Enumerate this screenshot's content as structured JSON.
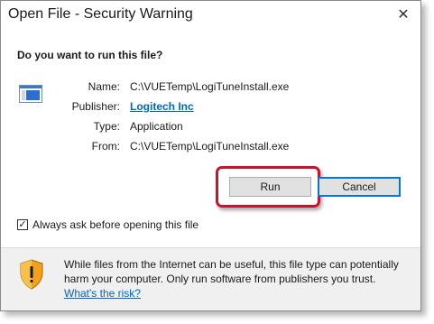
{
  "window": {
    "title": "Open File - Security Warning",
    "close_glyph": "✕"
  },
  "dialog": {
    "question": "Do you want to run this file?",
    "file_icon": "application-window-icon",
    "fields": {
      "name_label": "Name:",
      "name_value": "C:\\VUETemp\\LogiTuneInstall.exe",
      "publisher_label": "Publisher:",
      "publisher_value": "Logitech Inc",
      "type_label": "Type:",
      "type_value": "Application",
      "from_label": "From:",
      "from_value": "C:\\VUETemp\\LogiTuneInstall.exe"
    },
    "buttons": {
      "run": "Run",
      "cancel": "Cancel"
    },
    "checkbox": {
      "label": "Always ask before opening this file",
      "checked": true,
      "check_glyph": "✓"
    },
    "warning": {
      "icon": "security-shield-icon",
      "text": "While files from the Internet can be useful, this file type can potentially harm your computer. Only run software from publishers you trust.",
      "link": "What's the risk?"
    }
  },
  "colors": {
    "highlight_border": "#c8142a",
    "link": "#0066cc",
    "default_button_border": "#0078d7"
  }
}
